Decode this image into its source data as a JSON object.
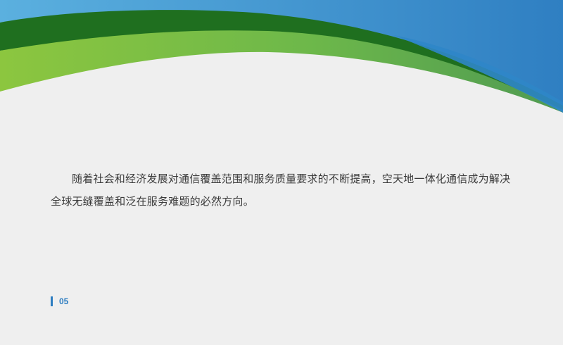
{
  "slide": {
    "body_text": "随着社会和经济发展对通信覆盖范围和服务质量要求的不断提高，空天地一体化通信成为解决全球无缝覆盖和泛在服务难题的必然方向。",
    "page_number": "05"
  },
  "theme": {
    "background": "#efefef",
    "accent_blue": "#2d7dc1",
    "light_blue": "#4a9fd4",
    "dark_green": "#1d6e1d",
    "light_green": "#7cc242"
  }
}
